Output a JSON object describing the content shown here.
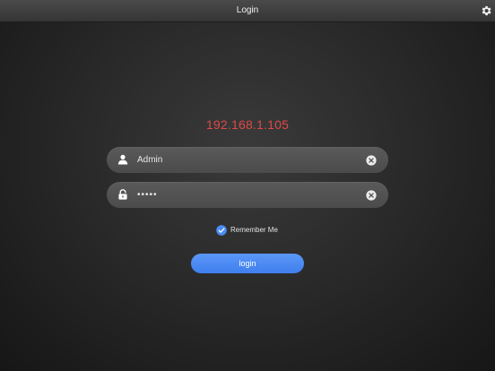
{
  "header": {
    "title": "Login"
  },
  "server": {
    "ip": "192.168.1.105"
  },
  "form": {
    "username_value": "Admin",
    "password_value": "•••••",
    "remember_label": "Remember Me",
    "remember_checked": true,
    "login_label": "login"
  },
  "colors": {
    "accent": "#4a8cf3",
    "ip_text": "#e04848"
  }
}
